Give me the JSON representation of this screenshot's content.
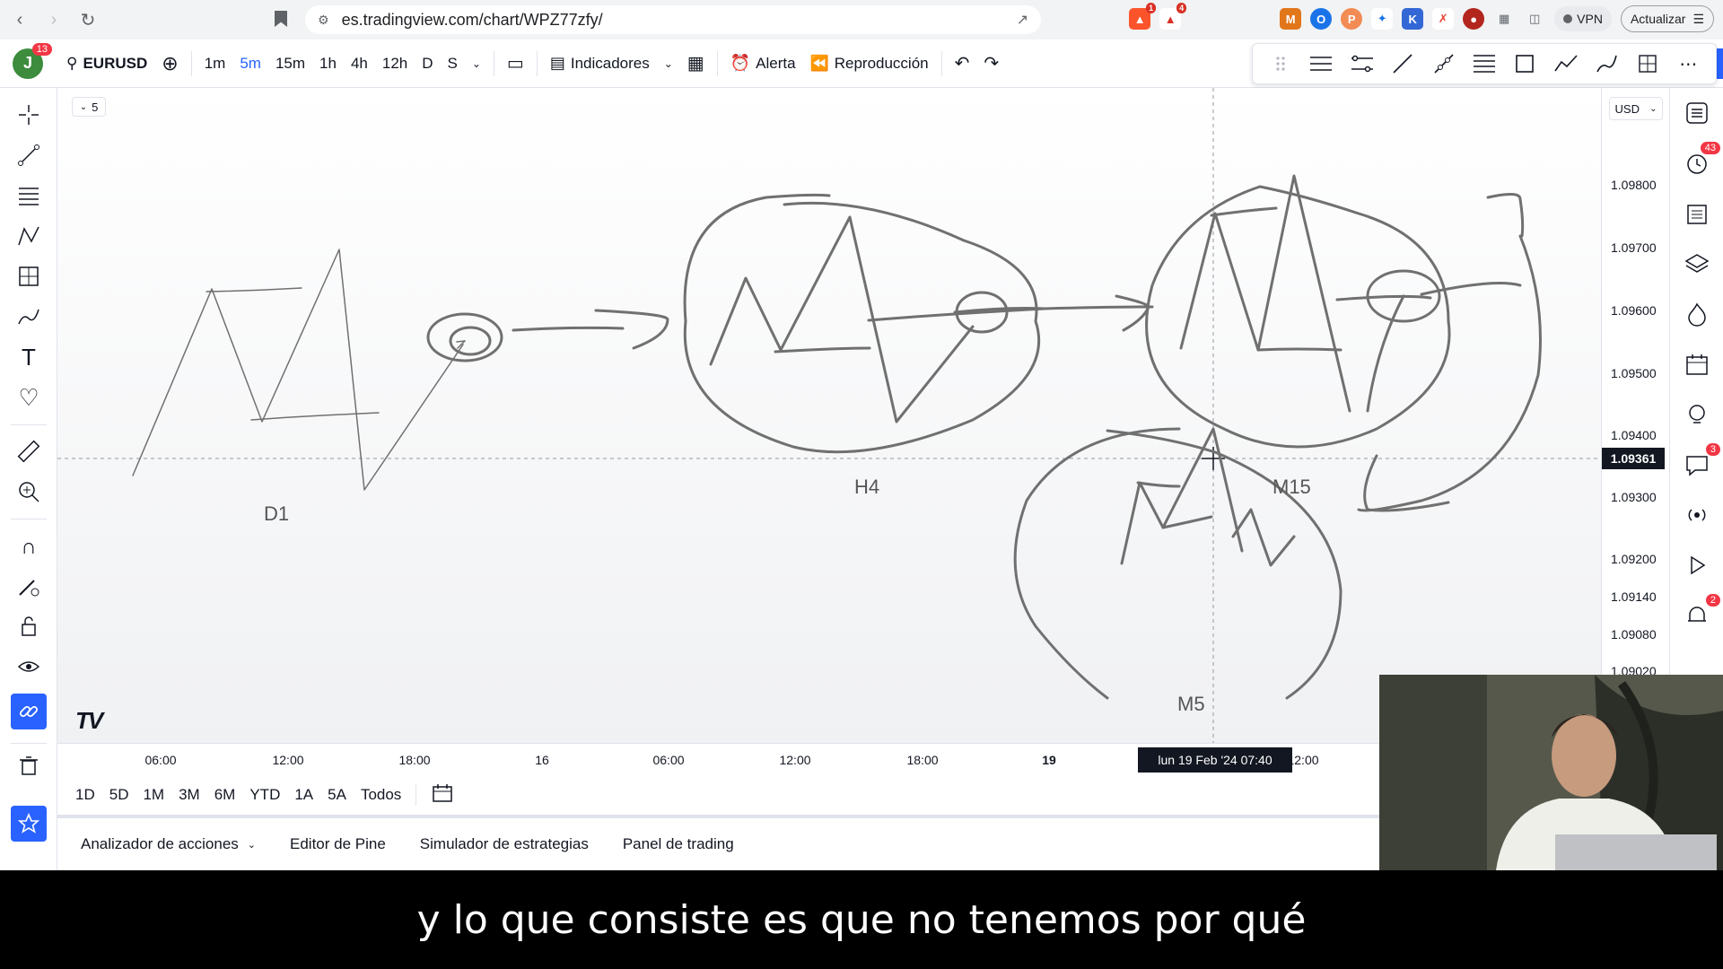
{
  "browser": {
    "url": "es.tradingview.com/chart/WPZ77zfy/",
    "vpn_label": "VPN",
    "update_label": "Actualizar",
    "ext_badges": [
      "1",
      "4"
    ]
  },
  "toolbar": {
    "avatar_letter": "J",
    "avatar_badge": "13",
    "symbol": "EURUSD",
    "intervals": [
      "1m",
      "5m",
      "15m",
      "1h",
      "4h",
      "12h",
      "D",
      "S"
    ],
    "active_interval": "5m",
    "indicators_label": "Indicadores",
    "alert_label": "Alerta",
    "replay_label": "Reproducción"
  },
  "chart": {
    "collapse_count": "5",
    "labels": {
      "d1": "D1",
      "h4": "H4",
      "m15": "M15",
      "m5": "M5"
    },
    "currency": "USD",
    "price_ticks": [
      "1.09800",
      "1.09700",
      "1.09600",
      "1.09500",
      "1.09400",
      "1.09300",
      "1.09200",
      "1.09140",
      "1.09080",
      "1.09020"
    ],
    "current_price": "1.09361",
    "time_ticks": [
      "06:00",
      "12:00",
      "18:00",
      "16",
      "06:00",
      "12:00",
      "18:00",
      "19",
      "12:00"
    ],
    "crosshair_time": "lun 19 Feb '24   07:40",
    "logo": "TV"
  },
  "range": {
    "items": [
      "1D",
      "5D",
      "1M",
      "3M",
      "6M",
      "YTD",
      "1A",
      "5A",
      "Todos"
    ]
  },
  "bottom_panel": {
    "tabs": [
      "Analizador de acciones",
      "Editor de Pine",
      "Simulador de estrategias",
      "Panel de trading"
    ]
  },
  "right_toolbar": {
    "badges": [
      "43",
      "3",
      "2"
    ]
  },
  "subtitle": "y lo que consiste es que no tenemos por qué",
  "colors": {
    "accent": "#2962ff",
    "badge": "#f23645",
    "drawing": "#666666"
  }
}
